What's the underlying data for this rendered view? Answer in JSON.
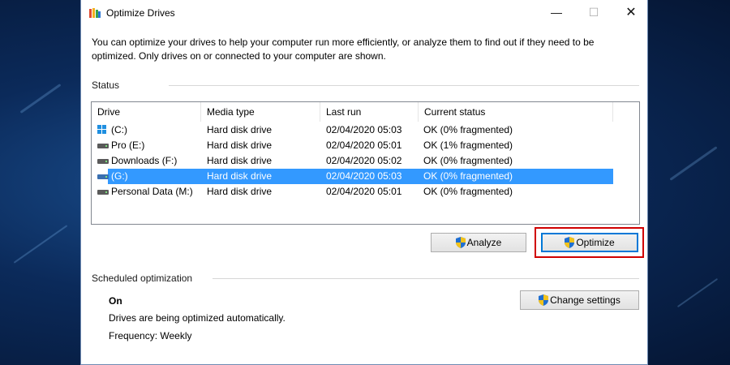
{
  "window": {
    "title": "Optimize Drives",
    "controls": {
      "minimize": "—",
      "maximize": "☐",
      "close": "✕"
    }
  },
  "description": "You can optimize your drives to help your computer run more efficiently, or analyze them to find out if they need to be optimized. Only drives on or connected to your computer are shown.",
  "status": {
    "title": "Status",
    "columns": [
      "Drive",
      "Media type",
      "Last run",
      "Current status"
    ],
    "rows": [
      {
        "drive": "(C:)",
        "media": "Hard disk drive",
        "last_run": "02/04/2020 05:03",
        "status": "OK (0% fragmented)",
        "icon": "windows-drive-icon",
        "selected": false
      },
      {
        "drive": "Pro (E:)",
        "media": "Hard disk drive",
        "last_run": "02/04/2020 05:01",
        "status": "OK (1% fragmented)",
        "icon": "hard-drive-icon",
        "selected": false
      },
      {
        "drive": "Downloads (F:)",
        "media": "Hard disk drive",
        "last_run": "02/04/2020 05:02",
        "status": "OK (0% fragmented)",
        "icon": "hard-drive-icon",
        "selected": false
      },
      {
        "drive": "(G:)",
        "media": "Hard disk drive",
        "last_run": "02/04/2020 05:03",
        "status": "OK (0% fragmented)",
        "icon": "hard-drive-icon",
        "selected": true
      },
      {
        "drive": "Personal Data (M:)",
        "media": "Hard disk drive",
        "last_run": "02/04/2020 05:01",
        "status": "OK (0% fragmented)",
        "icon": "hard-drive-icon",
        "selected": false
      }
    ]
  },
  "buttons": {
    "analyze": "Analyze",
    "optimize": "Optimize",
    "change_settings": "Change settings"
  },
  "scheduled": {
    "title": "Scheduled optimization",
    "state": "On",
    "detail": "Drives are being optimized automatically.",
    "frequency": "Frequency: Weekly"
  },
  "colors": {
    "selection": "#3399ff",
    "highlight_box": "#d00000",
    "shield_blue": "#1f6fd1",
    "shield_yellow": "#f2c21b"
  }
}
